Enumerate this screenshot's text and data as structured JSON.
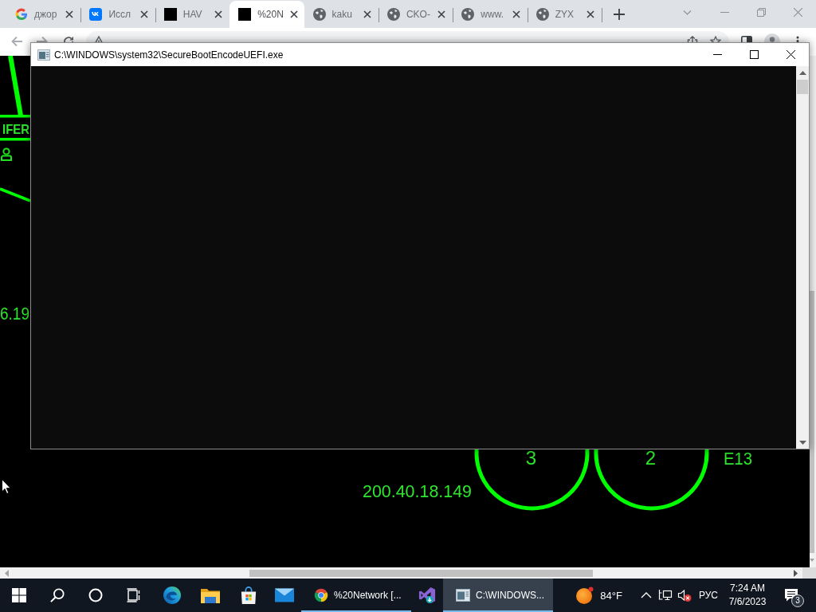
{
  "browser": {
    "tabs": [
      {
        "label": "джор",
        "kind": "google",
        "selected": false
      },
      {
        "label": "Иссл",
        "kind": "vk",
        "selected": false
      },
      {
        "label": "HAV",
        "kind": "square",
        "selected": false
      },
      {
        "label": "%20N",
        "kind": "square",
        "selected": true
      },
      {
        "label": "kaku",
        "kind": "globe",
        "selected": false
      },
      {
        "label": "CKO-",
        "kind": "globe",
        "selected": false
      },
      {
        "label": "www.",
        "kind": "globe",
        "selected": false
      },
      {
        "label": "ZYX",
        "kind": "globe",
        "selected": false
      }
    ]
  },
  "page": {
    "map": {
      "box_label": "IFER",
      "left_address": "6.19",
      "nodes": [
        {
          "number": "3"
        },
        {
          "number": "2"
        }
      ],
      "node_tag": "E13",
      "address": "200.40.18.149"
    }
  },
  "console": {
    "title": "C:\\WINDOWS\\system32\\SecureBootEncodeUEFI.exe"
  },
  "taskbar": {
    "apps": [
      {
        "kind": "edge",
        "running": false,
        "active": false
      },
      {
        "kind": "explorer",
        "running": false,
        "active": false
      },
      {
        "kind": "store",
        "running": false,
        "active": false
      },
      {
        "kind": "mail",
        "running": false,
        "active": false
      },
      {
        "kind": "chrome",
        "label": "%20Network [...",
        "running": true,
        "active": false
      },
      {
        "kind": "visual-studio",
        "running": false,
        "active": false
      },
      {
        "kind": "console",
        "label": "C:\\WINDOWS...",
        "running": true,
        "active": true
      }
    ],
    "weather": {
      "temperature": "84°F"
    },
    "tray": {
      "volume_muted": true,
      "language": "РУС",
      "time": "7:24 AM",
      "date": "7/6/2023",
      "notifications": "3"
    }
  }
}
